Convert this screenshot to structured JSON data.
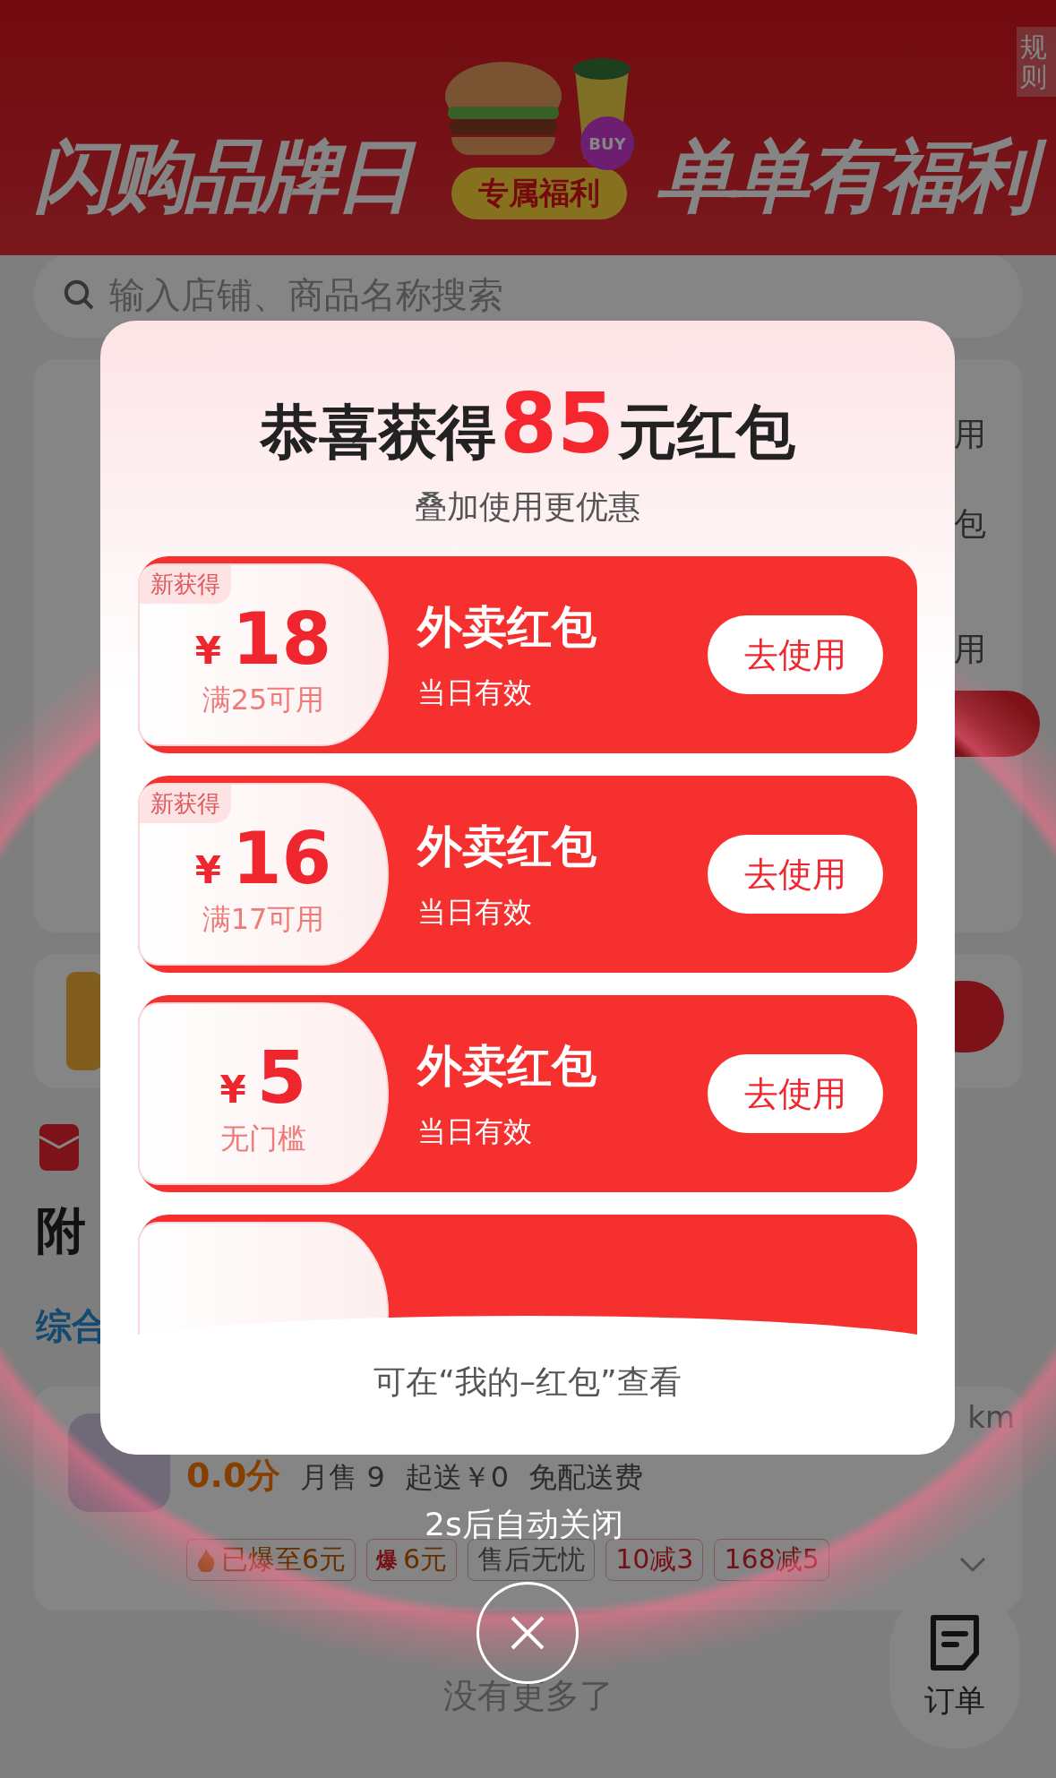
{
  "background_page": {
    "banner": {
      "title_left": "闪购品牌日",
      "badge": "专属福利",
      "sticker": "BUY",
      "title_right": "单单有福利",
      "rules": "规则"
    },
    "search": {
      "placeholder": "输入店铺、商品名称搜索"
    },
    "right_card": {
      "label_1": "用",
      "label_2": "包",
      "label_3": "用"
    },
    "nearby_title": "附",
    "filter_tab": "综合",
    "shop": {
      "distance": "km",
      "rating": "0.0分",
      "monthly_sales": "月售 9",
      "min_order": "起送￥0",
      "delivery": "免配送费",
      "tags": [
        {
          "kind": "fire",
          "text": "已爆至6元"
        },
        {
          "kind": "hot",
          "mark": "爆",
          "text": "6元"
        },
        {
          "kind": "plain",
          "text": "售后无忧"
        },
        {
          "kind": "discount",
          "text": "10减3"
        },
        {
          "kind": "discount",
          "text": "168减5"
        }
      ]
    },
    "end_text": "没有更多了",
    "order_button": "订单"
  },
  "popup": {
    "title_before": "恭喜获得",
    "amount": "85",
    "title_after": "元红包",
    "subtitle": "叠加使用更优惠",
    "coupons": [
      {
        "tag": "新获得",
        "currency": "¥",
        "amount": "18",
        "condition": "满25可用",
        "title": "外卖红包",
        "validity": "当日有效",
        "button": "去使用"
      },
      {
        "tag": "新获得",
        "currency": "¥",
        "amount": "16",
        "condition": "满17可用",
        "title": "外卖红包",
        "validity": "当日有效",
        "button": "去使用"
      },
      {
        "currency": "¥",
        "amount": "5",
        "condition": "无门槛",
        "title": "外卖红包",
        "validity": "当日有效",
        "button": "去使用"
      }
    ],
    "footer": "可在“我的–红包”查看"
  },
  "auto_close": "2s后自动关闭"
}
